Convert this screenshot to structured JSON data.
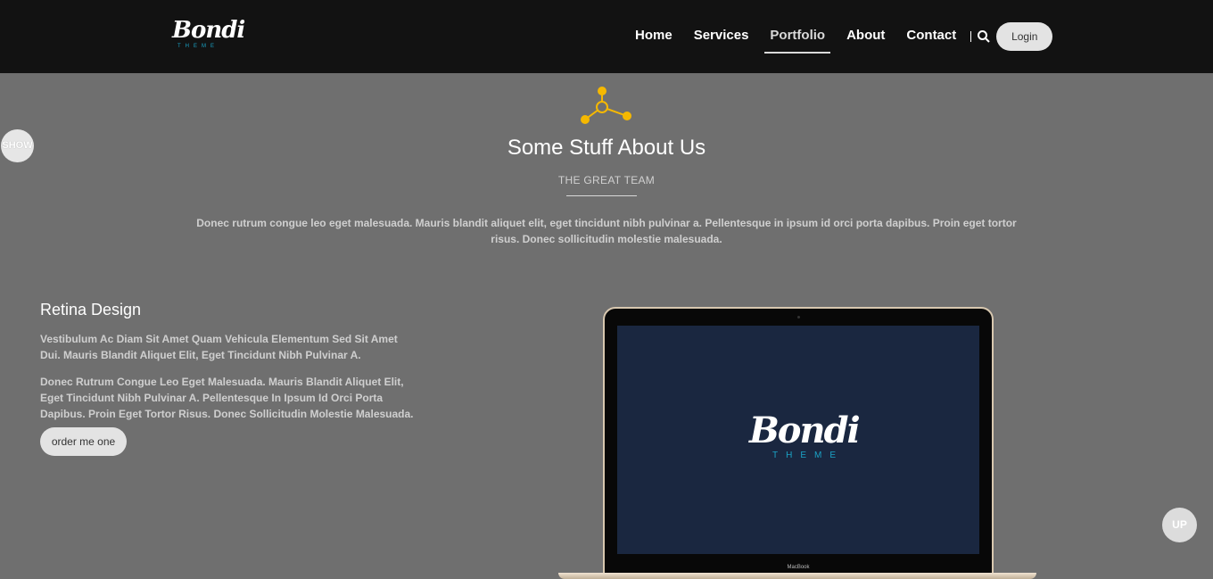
{
  "header": {
    "logo": {
      "name": "Bondi",
      "sub": "THEME"
    },
    "nav": [
      {
        "label": "Home",
        "active": false
      },
      {
        "label": "Services",
        "active": false
      },
      {
        "label": "Portfolio",
        "active": true
      },
      {
        "label": "About",
        "active": false
      },
      {
        "label": "Contact",
        "active": false
      }
    ],
    "search_icon": "search-icon",
    "login_label": "Login"
  },
  "side": {
    "show_label": "SHOW",
    "up_label": "UP"
  },
  "about": {
    "icon": "molecule-icon",
    "title": "Some Stuff About Us",
    "subtitle": "THE GREAT TEAM",
    "text": "Donec rutrum congue leo eget malesuada. Mauris blandit aliquet elit, eget tincidunt nibh pulvinar a. Pellentesque in ipsum id orci porta dapibus. Proin eget tortor risus. Donec sollicitudin molestie malesuada."
  },
  "feature": {
    "title": "Retina Design",
    "p1": "Vestibulum Ac Diam Sit Amet Quam Vehicula Elementum Sed Sit Amet Dui. Mauris Blandit Aliquet Elit, Eget Tincidunt Nibh Pulvinar A.",
    "p2": "Donec Rutrum Congue Leo Eget Malesuada. Mauris Blandit Aliquet Elit, Eget Tincidunt Nibh Pulvinar A. Pellentesque In Ipsum Id Orci Porta Dapibus. Proin Eget Tortor Risus. Donec Sollicitudin Molestie Malesuada.",
    "button_label": "order me one"
  },
  "laptop": {
    "screen_logo": {
      "name": "Bondi",
      "sub": "THEME"
    },
    "brand": "MacBook"
  },
  "colors": {
    "header_bg": "#121212",
    "page_bg": "#6f6f6f",
    "accent_yellow": "#f5b800",
    "logo_teal": "#1aa3c6",
    "screen_bg": "#1a2740"
  }
}
